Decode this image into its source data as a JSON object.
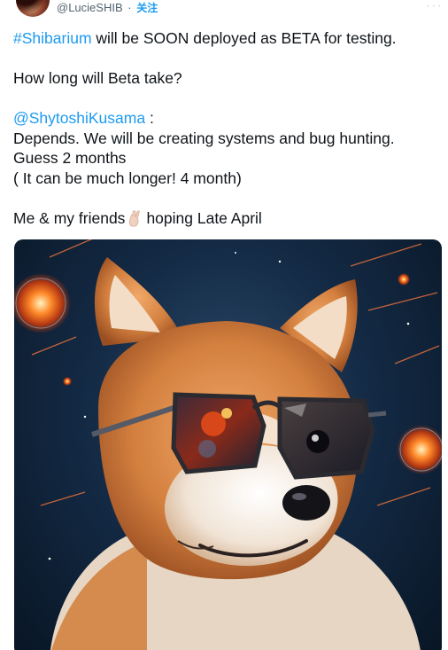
{
  "header": {
    "handle": "@LucieSHIB",
    "separator": "·",
    "follow_label": "关注"
  },
  "tweet": {
    "line1_hashtag": "#Shibarium",
    "line1_rest": " will be SOON deployed as BETA  for testing.",
    "line2": "How long will Beta take?",
    "line3_mention": "@ShytoshiKusama",
    "line3_rest": " :",
    "line4": "Depends. We will be creating systems and bug hunting.",
    "line5": "Guess 2 months",
    "line6": "( It can be much longer!  4 month)",
    "line7_before": "Me & my friends",
    "line7_after": "hoping Late April"
  },
  "media": {
    "icon": "shiba-inu-with-sunglasses-image"
  },
  "colors": {
    "link": "#1d9bf0",
    "text": "#0f1419",
    "muted": "#536471"
  }
}
